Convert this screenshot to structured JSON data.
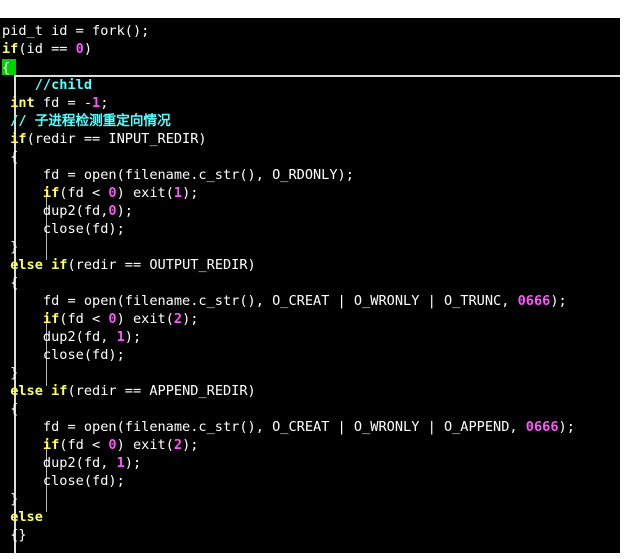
{
  "editor": {
    "lines": [
      [
        {
          "t": "pid_t id = fork();",
          "c": "txt"
        }
      ],
      [
        {
          "t": "if",
          "c": "kw"
        },
        {
          "t": "(id == ",
          "c": "txt"
        },
        {
          "t": "0",
          "c": "num"
        },
        {
          "t": ")",
          "c": "txt"
        }
      ],
      [
        {
          "t": "{",
          "c": "cursor"
        }
      ],
      [
        {
          "t": "    //child",
          "c": "cmt"
        }
      ],
      [
        {
          "t": " ",
          "c": "txt"
        },
        {
          "t": "int",
          "c": "kw"
        },
        {
          "t": " fd = -",
          "c": "txt"
        },
        {
          "t": "1",
          "c": "num"
        },
        {
          "t": ";",
          "c": "txt"
        }
      ],
      [
        {
          "t": " // 子进程检测重定向情况",
          "c": "cmt"
        }
      ],
      [
        {
          "t": " ",
          "c": "txt"
        },
        {
          "t": "if",
          "c": "kw"
        },
        {
          "t": "(redir == INPUT_REDIR)",
          "c": "txt"
        }
      ],
      [
        {
          "t": " {",
          "c": "txt"
        }
      ],
      [
        {
          "t": "     fd = open(filename.c_str(), O_RDONLY);",
          "c": "txt"
        }
      ],
      [
        {
          "t": "     ",
          "c": "txt"
        },
        {
          "t": "if",
          "c": "kw"
        },
        {
          "t": "(fd < ",
          "c": "txt"
        },
        {
          "t": "0",
          "c": "num"
        },
        {
          "t": ") exit(",
          "c": "txt"
        },
        {
          "t": "1",
          "c": "num"
        },
        {
          "t": ");",
          "c": "txt"
        }
      ],
      [
        {
          "t": "     dup2(fd,",
          "c": "txt"
        },
        {
          "t": "0",
          "c": "num"
        },
        {
          "t": ");",
          "c": "txt"
        }
      ],
      [
        {
          "t": "     close(fd);",
          "c": "txt"
        }
      ],
      [
        {
          "t": " }",
          "c": "txt"
        }
      ],
      [
        {
          "t": " ",
          "c": "txt"
        },
        {
          "t": "else",
          "c": "kw"
        },
        {
          "t": " ",
          "c": "txt"
        },
        {
          "t": "if",
          "c": "kw"
        },
        {
          "t": "(redir == OUTPUT_REDIR)",
          "c": "txt"
        }
      ],
      [
        {
          "t": " {",
          "c": "txt"
        }
      ],
      [
        {
          "t": "     fd = open(filename.c_str(), O_CREAT | O_WRONLY | O_TRUNC, ",
          "c": "txt"
        },
        {
          "t": "0666",
          "c": "num"
        },
        {
          "t": ");",
          "c": "txt"
        }
      ],
      [
        {
          "t": "     ",
          "c": "txt"
        },
        {
          "t": "if",
          "c": "kw"
        },
        {
          "t": "(fd < ",
          "c": "txt"
        },
        {
          "t": "0",
          "c": "num"
        },
        {
          "t": ") exit(",
          "c": "txt"
        },
        {
          "t": "2",
          "c": "num"
        },
        {
          "t": ");",
          "c": "txt"
        }
      ],
      [
        {
          "t": "     dup2(fd, ",
          "c": "txt"
        },
        {
          "t": "1",
          "c": "num"
        },
        {
          "t": ");",
          "c": "txt"
        }
      ],
      [
        {
          "t": "     close(fd);",
          "c": "txt"
        }
      ],
      [
        {
          "t": " }",
          "c": "txt"
        }
      ],
      [
        {
          "t": " ",
          "c": "txt"
        },
        {
          "t": "else",
          "c": "kw"
        },
        {
          "t": " ",
          "c": "txt"
        },
        {
          "t": "if",
          "c": "kw"
        },
        {
          "t": "(redir == APPEND_REDIR)",
          "c": "txt"
        }
      ],
      [
        {
          "t": " {",
          "c": "txt"
        }
      ],
      [
        {
          "t": "     fd = open(filename.c_str(), O_CREAT | O_WRONLY | O_APPEND, ",
          "c": "txt"
        },
        {
          "t": "0666",
          "c": "num"
        },
        {
          "t": ");",
          "c": "txt"
        }
      ],
      [
        {
          "t": "     ",
          "c": "txt"
        },
        {
          "t": "if",
          "c": "kw"
        },
        {
          "t": "(fd < ",
          "c": "txt"
        },
        {
          "t": "0",
          "c": "num"
        },
        {
          "t": ") exit(",
          "c": "txt"
        },
        {
          "t": "2",
          "c": "num"
        },
        {
          "t": ");",
          "c": "txt"
        }
      ],
      [
        {
          "t": "     dup2(fd, ",
          "c": "txt"
        },
        {
          "t": "1",
          "c": "num"
        },
        {
          "t": ");",
          "c": "txt"
        }
      ],
      [
        {
          "t": "     close(fd);",
          "c": "txt"
        }
      ],
      [
        {
          "t": " }",
          "c": "txt"
        }
      ],
      [
        {
          "t": " ",
          "c": "txt"
        },
        {
          "t": "else",
          "c": "kw"
        }
      ],
      [
        {
          "t": " {}",
          "c": "txt"
        }
      ]
    ]
  },
  "colors": {
    "background": "#000000",
    "text": "#ffffff",
    "keyword": "#ffff54",
    "number": "#ff54ff",
    "comment": "#54ffff",
    "cursor": "#00d000"
  }
}
